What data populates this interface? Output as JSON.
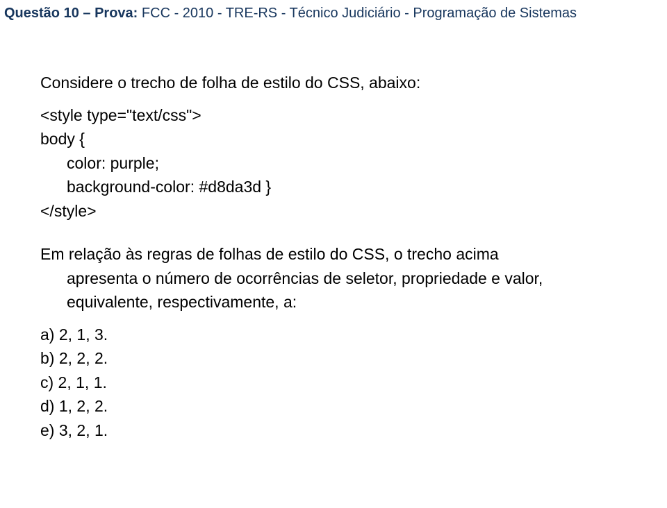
{
  "header": {
    "questao_label": "Questão",
    "questao_number": "10",
    "separator": "–",
    "prova_label": "Prova:",
    "prova_desc": "FCC - 2010 - TRE-RS - Técnico Judiciário - Programação de Sistemas"
  },
  "content": {
    "intro": "Considere o trecho de folha de estilo do CSS, abaixo:",
    "code": {
      "l1": "<style type=\"text/css\">",
      "l2": "body {",
      "l3": "color: purple;",
      "l4": "background-color: #d8da3d }",
      "l5": "</style>"
    },
    "question": {
      "line1": "Em relação às regras de folhas de estilo do CSS, o trecho acima",
      "line2": "apresenta o número de ocorrências de seletor, propriedade e valor,",
      "line3": "equivalente, respectivamente, a:"
    },
    "options": {
      "a": "a) 2, 1, 3.",
      "b": "b) 2, 2, 2.",
      "c": "c) 2, 1, 1.",
      "d": "d) 1, 2, 2.",
      "e": "e) 3, 2, 1."
    }
  }
}
